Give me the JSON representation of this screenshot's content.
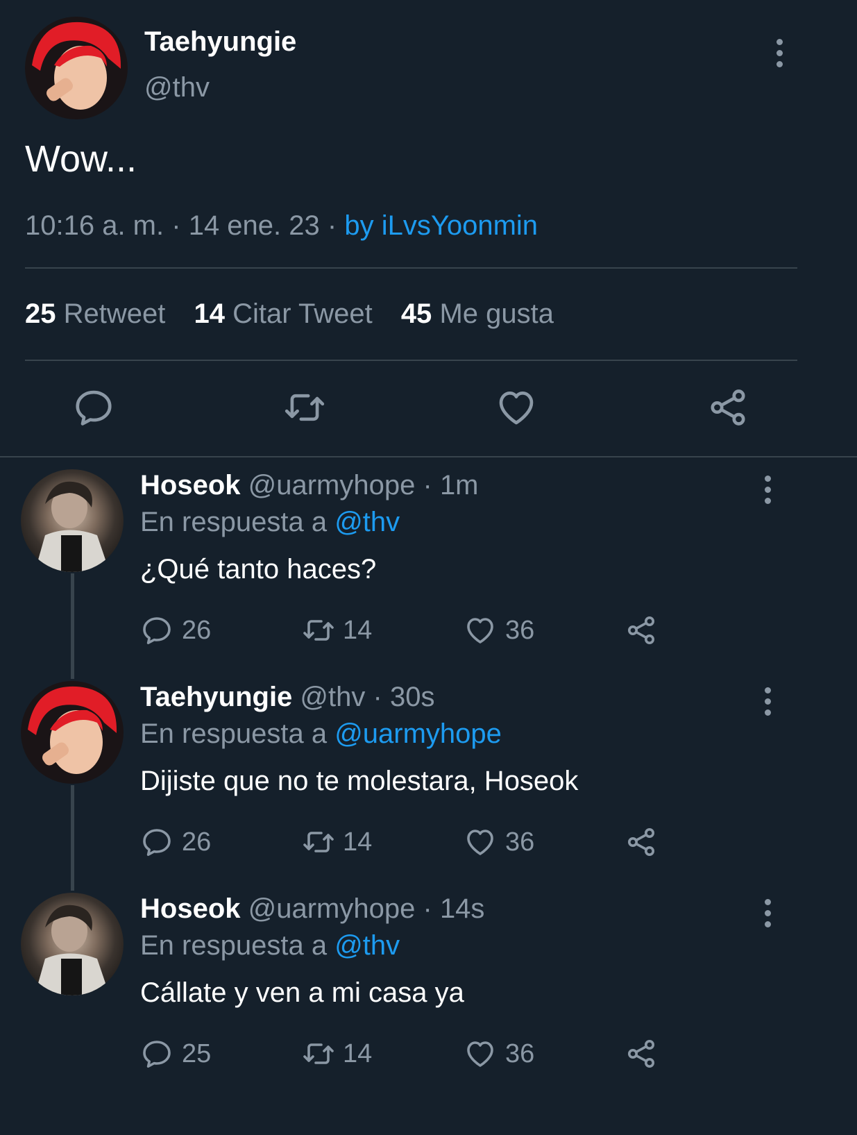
{
  "main_tweet": {
    "display_name": "Taehyungie",
    "handle": "@thv",
    "text": "Wow...",
    "time": "10:16 a. m.",
    "sep1": "·",
    "date": "14 ene. 23",
    "sep2": "·",
    "source": "by iLvsYoonmin",
    "stats": {
      "retweets_count": "25",
      "retweets_label": "Retweet",
      "quotes_count": "14",
      "quotes_label": "Citar Tweet",
      "likes_count": "45",
      "likes_label": "Me gusta"
    }
  },
  "replies": [
    {
      "display_name": "Hoseok",
      "handle": "@uarmyhope",
      "dot": "·",
      "time": "1m",
      "reply_prefix": "En respuesta a",
      "reply_to": "@thv",
      "text": "¿Qué tanto haces?",
      "replies": "26",
      "retweets": "14",
      "likes": "36"
    },
    {
      "display_name": "Taehyungie",
      "handle": "@thv",
      "dot": "·",
      "time": "30s",
      "reply_prefix": "En respuesta a",
      "reply_to": "@uarmyhope",
      "text": "Dijiste que no te molestara, Hoseok",
      "replies": "26",
      "retweets": "14",
      "likes": "36"
    },
    {
      "display_name": "Hoseok",
      "handle": "@uarmyhope",
      "dot": "·",
      "time": "14s",
      "reply_prefix": "En respuesta a",
      "reply_to": "@thv",
      "text": "Cállate y ven a mi casa ya",
      "replies": "25",
      "retweets": "14",
      "likes": "36"
    }
  ],
  "colors": {
    "background": "#15202b",
    "accent": "#1d9bf0",
    "muted": "#8b98a5",
    "divider": "#38444d"
  }
}
